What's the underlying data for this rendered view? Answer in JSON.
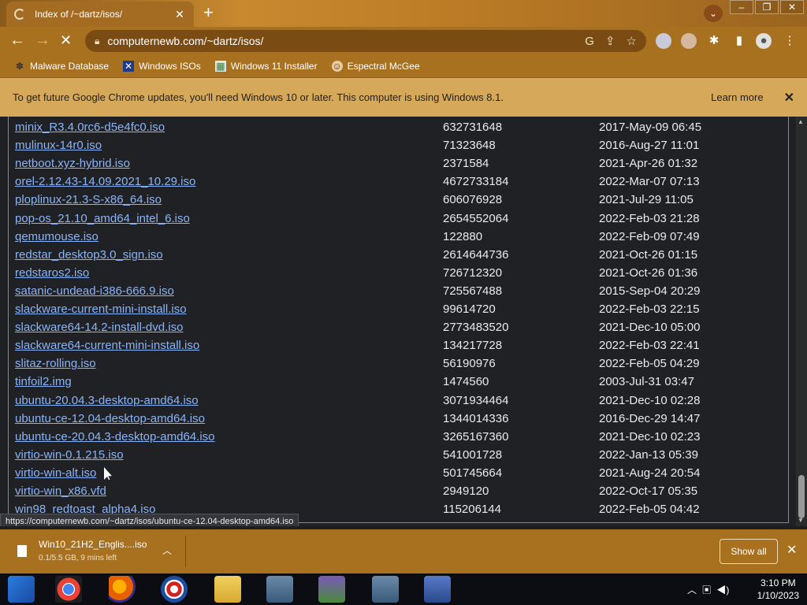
{
  "tab": {
    "title": "Index of /~dartz/isos/",
    "close": "✕"
  },
  "toolbar": {
    "url": "computernewb.com/~dartz/isos/"
  },
  "bookmarks": [
    {
      "label": "Malware Database",
      "icon": "bug-icon"
    },
    {
      "label": "Windows ISOs",
      "icon": "x-logo-icon"
    },
    {
      "label": "Windows 11 Installer",
      "icon": "image-icon"
    },
    {
      "label": "Espectral McGee",
      "icon": "avatar-icon"
    }
  ],
  "infobar": {
    "message": "To get future Google Chrome updates, you'll need Windows 10 or later. This computer is using Windows 8.1.",
    "learn_more": "Learn more"
  },
  "files": [
    {
      "name": "minix_R3.4.0rc6-d5e4fc0.iso",
      "size": "632731648",
      "date": "2017-May-09 06:45"
    },
    {
      "name": "mulinux-14r0.iso",
      "size": "71323648",
      "date": "2016-Aug-27 11:01"
    },
    {
      "name": "netboot.xyz-hybrid.iso",
      "size": "2371584",
      "date": "2021-Apr-26 01:32"
    },
    {
      "name": "orel-2.12.43-14.09.2021_10.29.iso",
      "size": "4672733184",
      "date": "2022-Mar-07 07:13"
    },
    {
      "name": "ploplinux-21.3-S-x86_64.iso",
      "size": "606076928",
      "date": "2021-Jul-29 11:05"
    },
    {
      "name": "pop-os_21.10_amd64_intel_6.iso",
      "size": "2654552064",
      "date": "2022-Feb-03 21:28"
    },
    {
      "name": "qemumouse.iso",
      "size": "122880",
      "date": "2022-Feb-09 07:49"
    },
    {
      "name": "redstar_desktop3.0_sign.iso",
      "size": "2614644736",
      "date": "2021-Oct-26 01:15"
    },
    {
      "name": "redstaros2.iso",
      "size": "726712320",
      "date": "2021-Oct-26 01:36"
    },
    {
      "name": "satanic-undead-i386-666.9.iso",
      "size": "725567488",
      "date": "2015-Sep-04 20:29"
    },
    {
      "name": "slackware-current-mini-install.iso",
      "size": "99614720",
      "date": "2022-Feb-03 22:15"
    },
    {
      "name": "slackware64-14.2-install-dvd.iso",
      "size": "2773483520",
      "date": "2021-Dec-10 05:00"
    },
    {
      "name": "slackware64-current-mini-install.iso",
      "size": "134217728",
      "date": "2022-Feb-03 22:41"
    },
    {
      "name": "slitaz-rolling.iso",
      "size": "56190976",
      "date": "2022-Feb-05 04:29"
    },
    {
      "name": "tinfoil2.img",
      "size": "1474560",
      "date": "2003-Jul-31 03:47"
    },
    {
      "name": "ubuntu-20.04.3-desktop-amd64.iso",
      "size": "3071934464",
      "date": "2021-Dec-10 02:28"
    },
    {
      "name": "ubuntu-ce-12.04-desktop-amd64.iso",
      "size": "1344014336",
      "date": "2016-Dec-29 14:47"
    },
    {
      "name": "ubuntu-ce-20.04.3-desktop-amd64.iso",
      "size": "3265167360",
      "date": "2021-Dec-10 02:23"
    },
    {
      "name": "virtio-win-0.1.215.iso",
      "size": "541001728",
      "date": "2022-Jan-13 05:39"
    },
    {
      "name": "virtio-win-alt.iso",
      "size": "501745664",
      "date": "2021-Aug-24 20:54"
    },
    {
      "name": "virtio-win_x86.vfd",
      "size": "2949120",
      "date": "2022-Oct-17 05:35"
    },
    {
      "name": "win98_redtoast_alpha4.iso",
      "size": "115206144",
      "date": "2022-Feb-05 04:42"
    }
  ],
  "status_url": "https://computernewb.com/~dartz/isos/ubuntu-ce-12.04-desktop-amd64.iso",
  "download": {
    "name": "Win10_21H2_Englis....iso",
    "status": "0.1/5.5 GB, 9 mins left"
  },
  "shelf": {
    "show_all": "Show all"
  },
  "taskbar": {
    "time": "3:10 PM",
    "date": "1/10/2023"
  },
  "colors": {
    "link": "#8ab4f8",
    "page_bg": "#202124",
    "chrome_theme": "#a8711f",
    "infobar": "#d5a85a"
  }
}
